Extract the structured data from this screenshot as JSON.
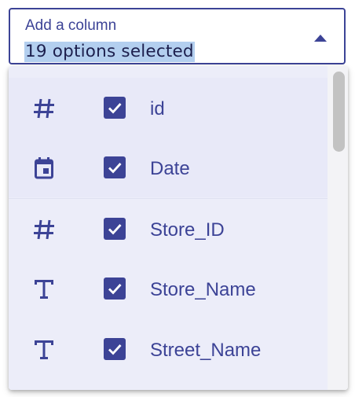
{
  "column_picker": {
    "label": "Add a column",
    "value": "19 options selected"
  },
  "options": [
    {
      "label": "id",
      "type_icon": "number-hash-icon",
      "checked": true
    },
    {
      "label": "Date",
      "type_icon": "calendar-icon",
      "checked": true
    },
    {
      "label": "Store_ID",
      "type_icon": "number-hash-icon",
      "checked": true
    },
    {
      "label": "Store_Name",
      "type_icon": "text-type-icon",
      "checked": true
    },
    {
      "label": "Street_Name",
      "type_icon": "text-type-icon",
      "checked": true
    }
  ],
  "colors": {
    "accent": "#3c4396",
    "list_background": "#ecedf9",
    "selection_highlight": "#b3cfef",
    "scrollbar_thumb": "#c2c2c2"
  }
}
